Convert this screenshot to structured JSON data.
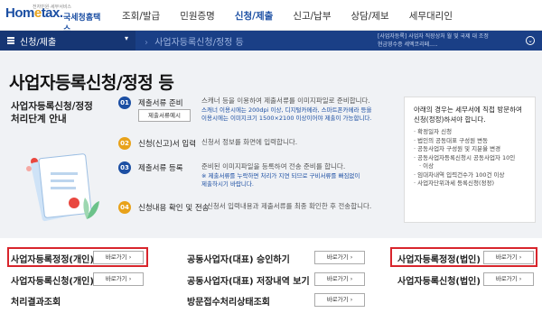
{
  "header": {
    "logo_sub": "전자민원·세무서비스",
    "logo_main": "Hometax",
    "logo_name": "국세청홈택스",
    "nav": [
      "조회/발급",
      "민원증명",
      "신청/제출",
      "신고/납부",
      "상담/제보",
      "세무대리인"
    ]
  },
  "subbar": {
    "menu_label": "신청/제출",
    "breadcrumb": "사업자등록신청/정정 등",
    "ticker_1": "[사업자등록] 사업자 직장상처 월 및 국제 대 조정",
    "ticker_2": "현금영수증 세엑코리페....."
  },
  "page": {
    "title": "사업자등록신청/정정 등",
    "left_label_1": "사업자등록신청/정정",
    "left_label_2": "처리단계 안내"
  },
  "steps": [
    {
      "num": "01",
      "label": "제출서류 준비",
      "desc_1": "스캐너 등을 이용하여 제출서류를 이미지파일로 준비합니다.",
      "desc_2": "스캐너 이용시에는 200dpi 이상, 디지털카메라, 스마트폰카메라 등을",
      "desc_3": "이용시에는 이미지크기 1500×2100 이상이어야 제출이 가능합니다.",
      "button": "제출서류예시"
    },
    {
      "num": "02",
      "label": "신청(신고)서 입력",
      "desc_1": "신청서 정보를 화면에 입력합니다."
    },
    {
      "num": "03",
      "label": "제출서류 등록",
      "desc_1": "준비된 이미지파일을 등록하여 전송 준비를 합니다.",
      "desc_2": "※ 제출서류를 누락하면 처리가 지연 되므로 구비서류를 빠짐없이",
      "desc_3": "제출하시기 바랍니다."
    },
    {
      "num": "04",
      "label": "신청내용 확인 및 전송",
      "desc_1": "신청서 입력내용과 제출서류를 최종 확인한 후 전송합니다."
    }
  ],
  "rightbox": {
    "head_1": "아래의 경우는 세무서에 직접 방문하여",
    "head_2": "신청(정정)하셔야 합니다.",
    "items": [
      "확정일자 신청",
      "법인의 공동대표 구성원 변동",
      "공동사업자 구성원 및 지분율 변경",
      "공동사업자등록신청시 공동사업자 10인",
      "이상",
      "임대차내역 입력건수가 100건 이상",
      "사업자단위과세 등록신청(정정)"
    ]
  },
  "links": [
    {
      "label": "사업자등록정정(개인)",
      "button": "바로가기"
    },
    {
      "label": "사업자등록신청(개인)",
      "button": "바로가기"
    },
    {
      "label": "처리결과조회"
    },
    {
      "label": "공동사업자(대표) 승인하기",
      "button": "바로가기"
    },
    {
      "label": "공동사업자(대표) 저장내역 보기",
      "button": "바로가기"
    },
    {
      "label": "방문접수처리상태조회",
      "button": "바로가기"
    },
    {
      "label": "사업자등록정정(법인)",
      "button": "바로가기"
    },
    {
      "label": "사업자등록신청(법인)",
      "button": "바로가기"
    }
  ],
  "colors": {
    "accent": "#1c4fa3",
    "navy": "#1a3f86",
    "highlight": "#d8252c",
    "step": "#e8a21a"
  }
}
